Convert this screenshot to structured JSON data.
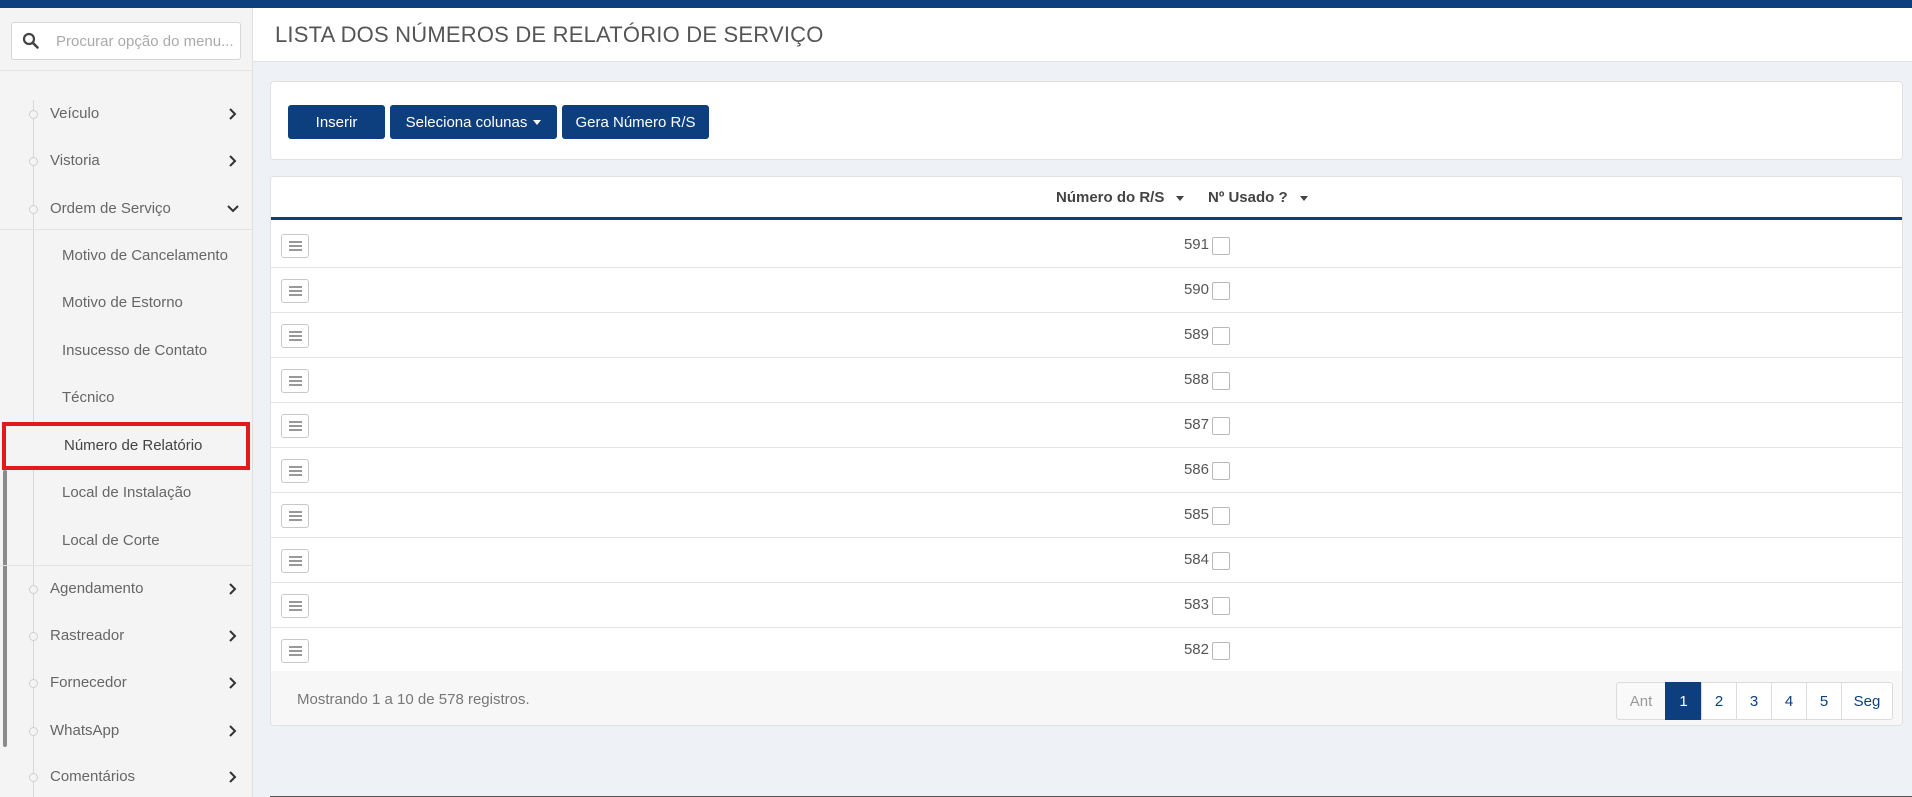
{
  "search": {
    "placeholder": "Procurar opção do menu..."
  },
  "sidebar": {
    "items": [
      {
        "label": "Veículo",
        "expanded": false
      },
      {
        "label": "Vistoria",
        "expanded": false
      },
      {
        "label": "Ordem de Serviço",
        "expanded": true
      },
      {
        "label": "Agendamento",
        "expanded": false
      },
      {
        "label": "Rastreador",
        "expanded": false
      },
      {
        "label": "Fornecedor",
        "expanded": false
      },
      {
        "label": "WhatsApp",
        "expanded": false
      },
      {
        "label": "Comentários",
        "expanded": false
      }
    ],
    "subitems": [
      {
        "label": "Motivo de Cancelamento"
      },
      {
        "label": "Motivo de Estorno"
      },
      {
        "label": "Insucesso de Contato"
      },
      {
        "label": "Técnico"
      },
      {
        "label": "Número de Relatório",
        "active": true
      },
      {
        "label": "Local de Instalação"
      },
      {
        "label": "Local de Corte"
      }
    ]
  },
  "header": {
    "title": "LISTA DOS NÚMEROS DE RELATÓRIO DE SERVIÇO"
  },
  "toolbar": {
    "insert_label": "Inserir",
    "columns_label": "Seleciona colunas",
    "generate_label": "Gera Número R/S"
  },
  "table": {
    "columns": [
      "Número do R/S",
      "Nº Usado ?"
    ],
    "rows": [
      {
        "number": "591",
        "used": false
      },
      {
        "number": "590",
        "used": false
      },
      {
        "number": "589",
        "used": false
      },
      {
        "number": "588",
        "used": false
      },
      {
        "number": "587",
        "used": false
      },
      {
        "number": "586",
        "used": false
      },
      {
        "number": "585",
        "used": false
      },
      {
        "number": "584",
        "used": false
      },
      {
        "number": "583",
        "used": false
      },
      {
        "number": "582",
        "used": false
      }
    ],
    "footer_info": "Mostrando 1 a 10 de 578 registros."
  },
  "pagination": {
    "prev": "Ant",
    "pages": [
      "1",
      "2",
      "3",
      "4",
      "5"
    ],
    "current": "1",
    "next": "Seg"
  },
  "colors": {
    "primary": "#0d3f7f",
    "highlight": "#e11b1b"
  }
}
